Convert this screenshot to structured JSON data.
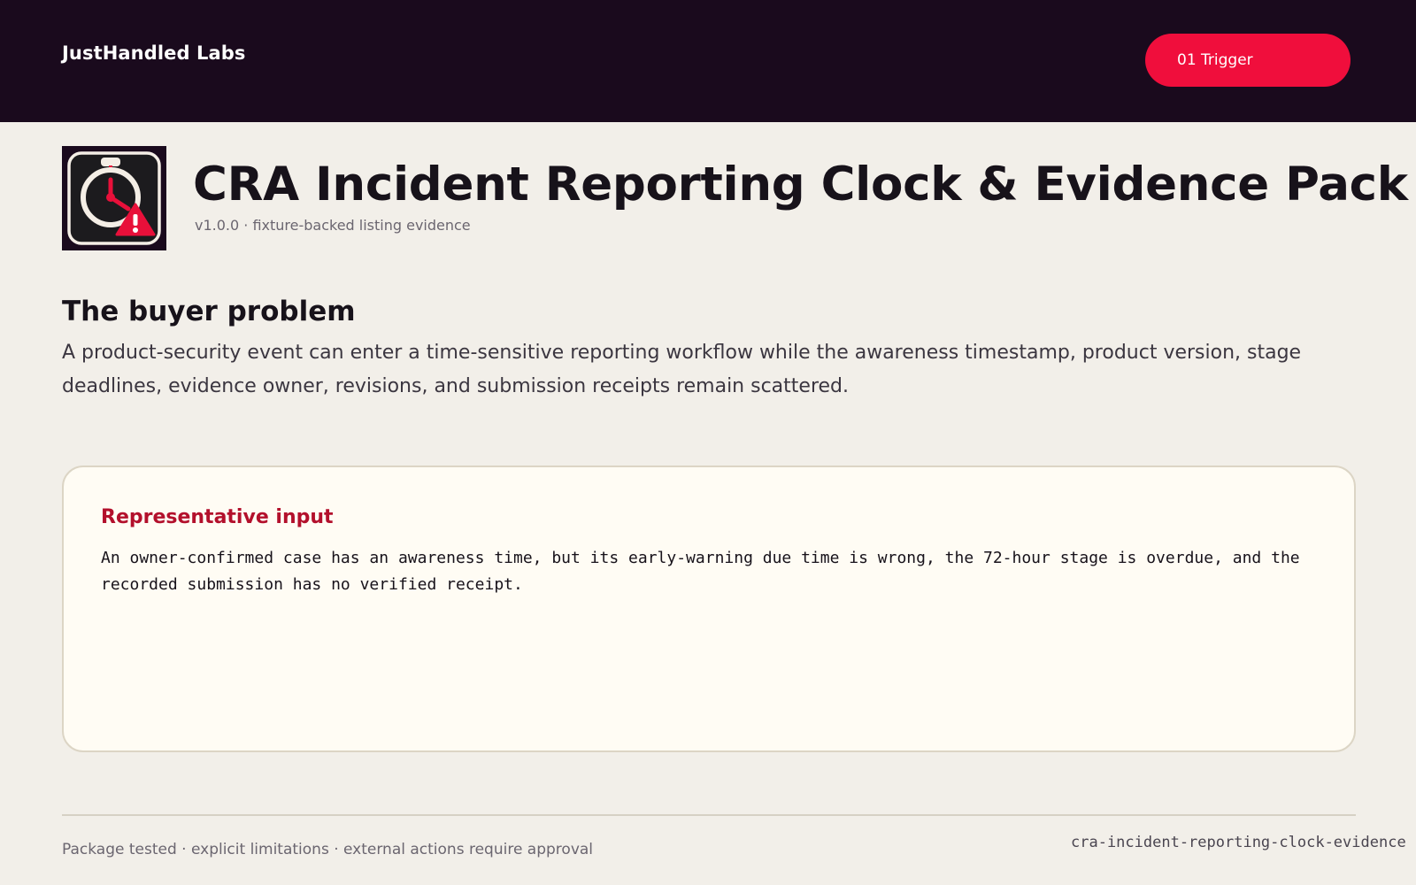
{
  "header": {
    "brand": "JustHandled Labs",
    "nav_pill_label": "01 Trigger"
  },
  "hero": {
    "icon": "stopwatch-warning-icon",
    "title": "CRA Incident Reporting Clock & Evidence Pack",
    "subtitle": "v1.0.0 · fixture-backed listing evidence"
  },
  "problem": {
    "heading": "The buyer problem",
    "body": "A product-security event can enter a time-sensitive reporting workflow while the awareness timestamp, product version, stage deadlines, evidence owner, revisions, and submission receipts remain scattered."
  },
  "input_card": {
    "heading": "Representative input",
    "body": "An owner-confirmed case has an awareness time, but its early-warning due time is wrong, the 72-hour stage is overdue, and the recorded submission has no verified receipt."
  },
  "footer": {
    "left": "Package tested · explicit limitations · external actions require approval",
    "right": "cra-incident-reporting-clock-evidence"
  },
  "colors": {
    "topbar": "#1a0a1d",
    "accent": "#f00e3c",
    "card_heading": "#b3102c",
    "background": "#f2efe9",
    "card": "#fffcf4"
  }
}
